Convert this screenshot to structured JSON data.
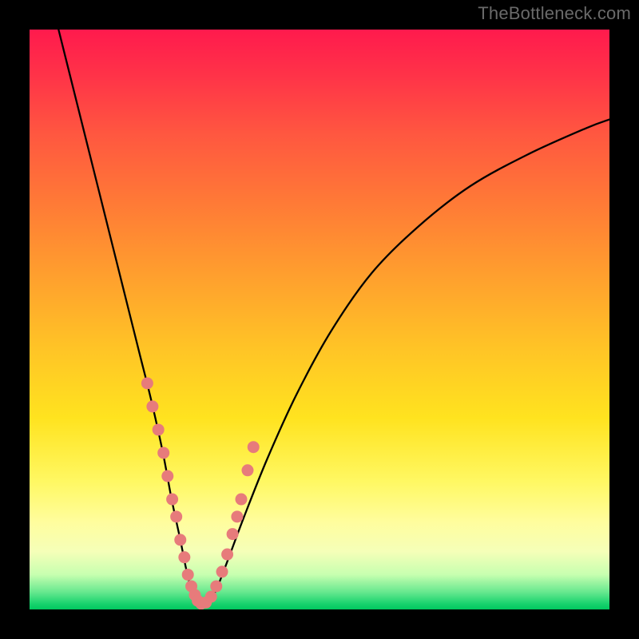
{
  "watermark": "TheBottleneck.com",
  "chart_data": {
    "type": "line",
    "title": "",
    "xlabel": "",
    "ylabel": "",
    "xlim": [
      0,
      100
    ],
    "ylim": [
      0,
      100
    ],
    "grid": false,
    "series": [
      {
        "name": "bottleneck-curve",
        "x": [
          5,
          7,
          9,
          11,
          13,
          15,
          17,
          19,
          21,
          23,
          24.5,
          26,
          27,
          28,
          28.8,
          29.5,
          30.5,
          32,
          34,
          37,
          41,
          46,
          52,
          59,
          67,
          76,
          86,
          96,
          100
        ],
        "values": [
          100,
          92,
          84,
          76,
          68,
          60,
          52,
          44,
          36,
          27,
          19,
          12,
          7,
          3,
          1,
          0.5,
          1,
          3,
          8,
          16,
          26,
          37,
          48,
          58,
          66,
          73,
          78.5,
          83,
          84.5
        ]
      }
    ],
    "markers": {
      "name": "highlight-dots",
      "color": "#e77b7b",
      "points_x": [
        20.3,
        21.2,
        22.2,
        23.1,
        23.8,
        24.6,
        25.3,
        26.0,
        26.7,
        27.3,
        27.9,
        28.5,
        29.0,
        29.6,
        30.4,
        31.3,
        32.2,
        33.2,
        34.1,
        35.0,
        35.8,
        36.5,
        37.6,
        38.6
      ],
      "points_y": [
        39,
        35,
        31,
        27,
        23,
        19,
        16,
        12,
        9,
        6,
        4,
        2.5,
        1.5,
        1,
        1.2,
        2.2,
        4,
        6.5,
        9.5,
        13,
        16,
        19,
        24,
        28
      ]
    },
    "background_gradient": {
      "top": "#ff1a4d",
      "mid": "#ffe31f",
      "bottom": "#00c85f"
    }
  }
}
